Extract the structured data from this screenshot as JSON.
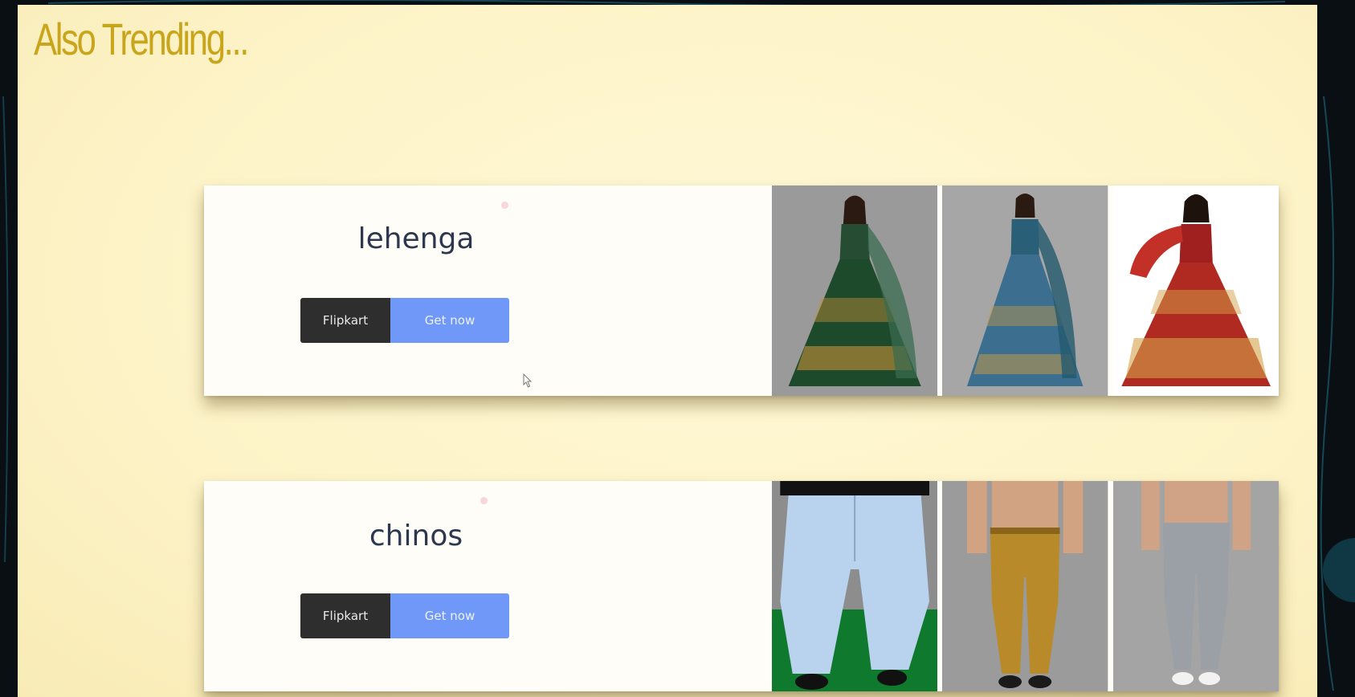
{
  "section": {
    "title": "Also Trending..."
  },
  "cards": [
    {
      "title": "lehenga",
      "store_label": "Flipkart",
      "action_label": "Get now",
      "images": [
        {
          "icon": "green-lehenga-image",
          "bg": "#9a9a9a",
          "top": "#264d33",
          "skirt": "#1e4a2c",
          "accent": "#c8913a",
          "drape": "#3a6b4f"
        },
        {
          "icon": "blue-lehenga-image",
          "bg": "#a6a6a6",
          "top": "#2a5f78",
          "skirt": "#3b6e8f",
          "accent": "#c39a4a",
          "drape": "#245a6e"
        },
        {
          "icon": "red-lehenga-image",
          "bg": "#ffffff",
          "top": "#a0201f",
          "skirt": "#b02a22",
          "accent": "#d4a24a",
          "drape": "#c23028"
        }
      ]
    },
    {
      "title": "chinos",
      "store_label": "Flipkart",
      "action_label": "Get now",
      "images": [
        {
          "icon": "light-blue-chinos-image",
          "bg": "#8d8d8d",
          "pants": "#b9d3ee",
          "floor": "#0f7a2e"
        },
        {
          "icon": "mustard-chinos-image",
          "bg": "#9b9b9b",
          "pants": "#b88a2a",
          "floor": "#9b9b9b"
        },
        {
          "icon": "grey-chinos-image",
          "bg": "#a4a4a4",
          "pants": "#9aa0a6",
          "floor": "#a4a4a4"
        }
      ]
    }
  ],
  "colors": {
    "page_bg": "#fdf3c7",
    "title": "#c9a51c",
    "store_button": "#2e2e2e",
    "action_button": "#7098f8"
  }
}
